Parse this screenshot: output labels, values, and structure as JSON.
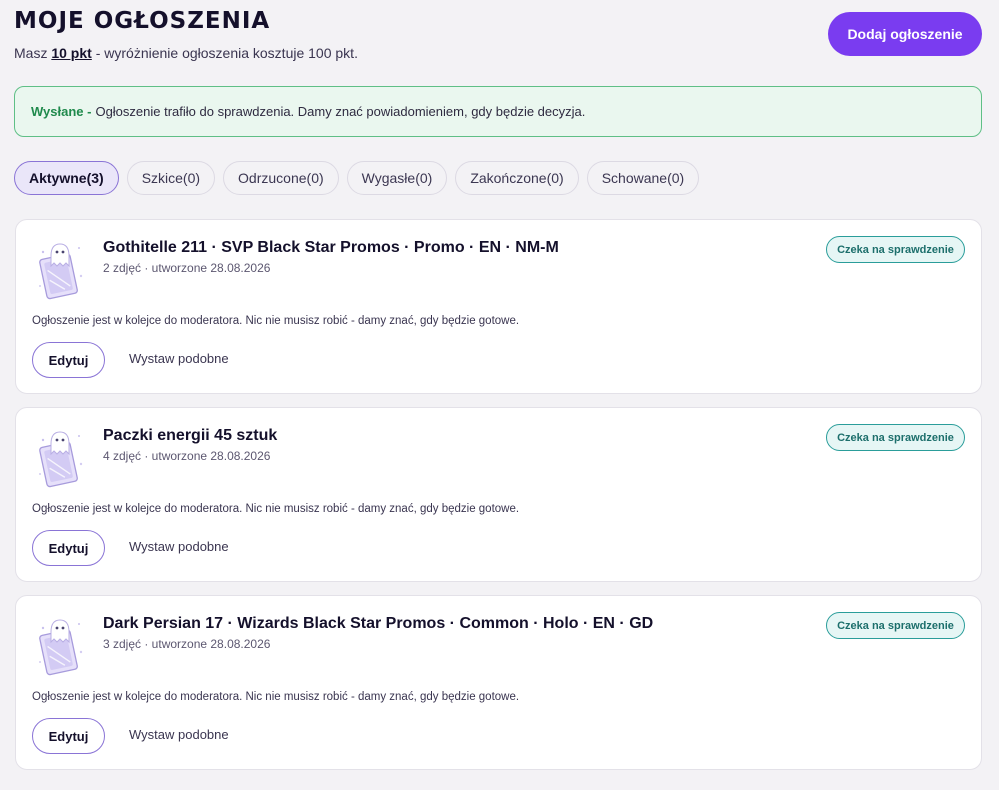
{
  "header": {
    "title": "MOJE OGŁOSZENIA",
    "subtitle_prefix": "Masz ",
    "points": "10 pkt",
    "subtitle_suffix": " - wyróżnienie ogłoszenia kosztuje 100 pkt.",
    "add_button": "Dodaj ogłoszenie"
  },
  "alert": {
    "strong": "Wysłane -",
    "text": "Ogłoszenie trafiło do sprawdzenia. Damy znać powiadomieniem, gdy będzie decyzja."
  },
  "tabs": [
    {
      "label": "Aktywne(3)",
      "active": true
    },
    {
      "label": "Szkice(0)"
    },
    {
      "label": "Odrzucone(0)"
    },
    {
      "label": "Wygasłe(0)"
    },
    {
      "label": "Zakończone(0)"
    },
    {
      "label": "Schowane(0)"
    }
  ],
  "listings": [
    {
      "title": "Gothitelle 211 · SVP Black Star Promos · Promo · EN · NM-M",
      "meta": "2 zdjęć · utworzone 28.08.2026",
      "status": "Czeka na sprawdzenie",
      "note": "Ogłoszenie jest w kolejce do moderatora. Nic nie musisz robić - damy znać, gdy będzie gotowe.",
      "edit_label": "Edytuj",
      "similar_label": "Wystaw podobne"
    },
    {
      "title": "Paczki energii 45 sztuk",
      "meta": "4 zdjęć · utworzone 28.08.2026",
      "status": "Czeka na sprawdzenie",
      "note": "Ogłoszenie jest w kolejce do moderatora. Nic nie musisz robić - damy znać, gdy będzie gotowe.",
      "edit_label": "Edytuj",
      "similar_label": "Wystaw podobne"
    },
    {
      "title": "Dark Persian 17 · Wizards Black Star Promos · Common · Holo · EN · GD",
      "meta": "3 zdjęć · utworzone 28.08.2026",
      "status": "Czeka na sprawdzenie",
      "note": "Ogłoszenie jest w kolejce do moderatora. Nic nie musisz robić - damy znać, gdy będzie gotowe.",
      "edit_label": "Edytuj",
      "similar_label": "Wystaw podobne"
    }
  ],
  "colors": {
    "accent": "#7a3cf0",
    "success": "#1f8a4c",
    "badge": "#2a9d9a"
  }
}
